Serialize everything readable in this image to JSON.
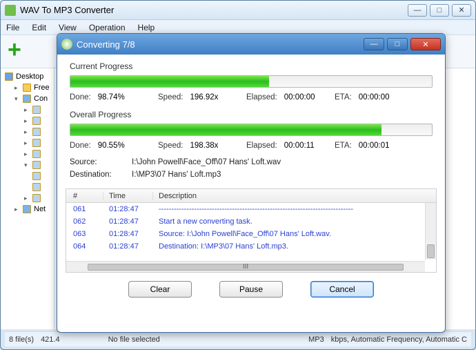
{
  "main": {
    "title": "WAV To MP3 Converter",
    "menu": {
      "file": "File",
      "edit": "Edit",
      "view": "View",
      "operation": "Operation",
      "help": "Help"
    },
    "tree": {
      "desktop": "Desktop",
      "free": "Free",
      "computer": "Con",
      "net": "Net"
    },
    "status": {
      "files": "8 file(s)",
      "size": "421.4",
      "selected": "No file selected",
      "format": "MP3",
      "rest": "kbps, Automatic Frequency, Automatic C"
    }
  },
  "dialog": {
    "title": "Converting 7/8",
    "current": {
      "label": "Current Progress",
      "pct": 55,
      "done_label": "Done:",
      "done_val": "98.74%",
      "speed_label": "Speed:",
      "speed_val": "196.92x",
      "elapsed_label": "Elapsed:",
      "elapsed_val": "00:00:00",
      "eta_label": "ETA:",
      "eta_val": "00:00:00"
    },
    "overall": {
      "label": "Overall Progress",
      "pct": 86,
      "done_label": "Done:",
      "done_val": "90.55%",
      "speed_label": "Speed:",
      "speed_val": "198.38x",
      "elapsed_label": "Elapsed:",
      "elapsed_val": "00:00:11",
      "eta_label": "ETA:",
      "eta_val": "00:00:01"
    },
    "source_label": "Source:",
    "source_val": "I:\\John Powell\\Face_Off\\07 Hans' Loft.wav",
    "dest_label": "Destination:",
    "dest_val": "I:\\MP3\\07 Hans' Loft.mp3",
    "log": {
      "head_n": "#",
      "head_t": "Time",
      "head_d": "Description",
      "rows": [
        {
          "n": "061",
          "t": "01:28:47",
          "d": "-----------------------------------------------------------------------------"
        },
        {
          "n": "062",
          "t": "01:28:47",
          "d": "Start a new converting task."
        },
        {
          "n": "063",
          "t": "01:28:47",
          "d": "Source:  I:\\John Powell\\Face_Off\\07 Hans' Loft.wav."
        },
        {
          "n": "064",
          "t": "01:28:47",
          "d": "Destination: I:\\MP3\\07 Hans' Loft.mp3."
        }
      ],
      "hmark": "III"
    },
    "buttons": {
      "clear": "Clear",
      "pause": "Pause",
      "cancel": "Cancel"
    }
  }
}
